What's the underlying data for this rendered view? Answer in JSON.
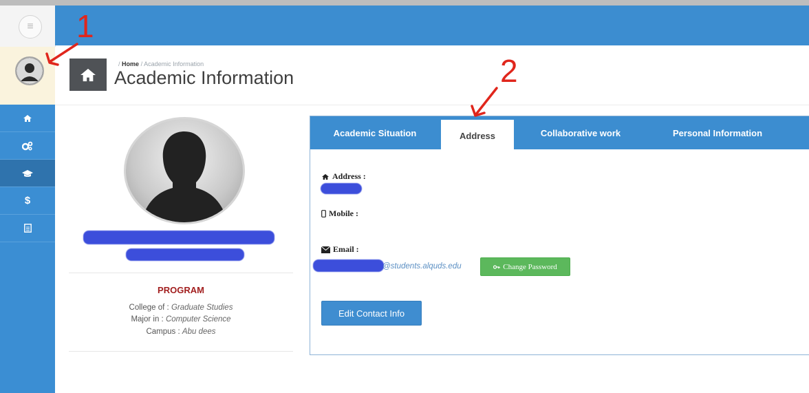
{
  "breadcrumb": {
    "home": "Home",
    "separator": "/",
    "current": "Academic Information"
  },
  "page": {
    "title": "Academic Information"
  },
  "sidebar": {
    "items": [
      {
        "icon": "home-icon"
      },
      {
        "icon": "cogs-icon"
      },
      {
        "icon": "graduation-cap-icon",
        "active": true
      },
      {
        "icon": "dollar-icon",
        "glyph": "$"
      },
      {
        "icon": "document-icon"
      }
    ]
  },
  "tabs": [
    {
      "label": "Academic Situation"
    },
    {
      "label": "Address",
      "active": true
    },
    {
      "label": "Collaborative work"
    },
    {
      "label": "Personal Information"
    }
  ],
  "contact": {
    "address_label": "Address :",
    "mobile_label": "Mobile :",
    "email_label": "Email :",
    "email_domain": "@students.alquds.edu",
    "change_password": "Change Password",
    "edit_button": "Edit Contact Info"
  },
  "program": {
    "title": "PROGRAM",
    "college_label": "College of :",
    "college": "Graduate Studies",
    "major_label": "Major in :",
    "major": "Computer Science",
    "campus_label": "Campus :",
    "campus": "Abu dees"
  },
  "annotations": {
    "one": "1",
    "two": "2",
    "color": "#e0261c"
  },
  "colors": {
    "primary": "#3c8dd0",
    "success": "#5cb85c",
    "program_title": "#a21f1f",
    "header_icon_box": "#4f5256"
  }
}
